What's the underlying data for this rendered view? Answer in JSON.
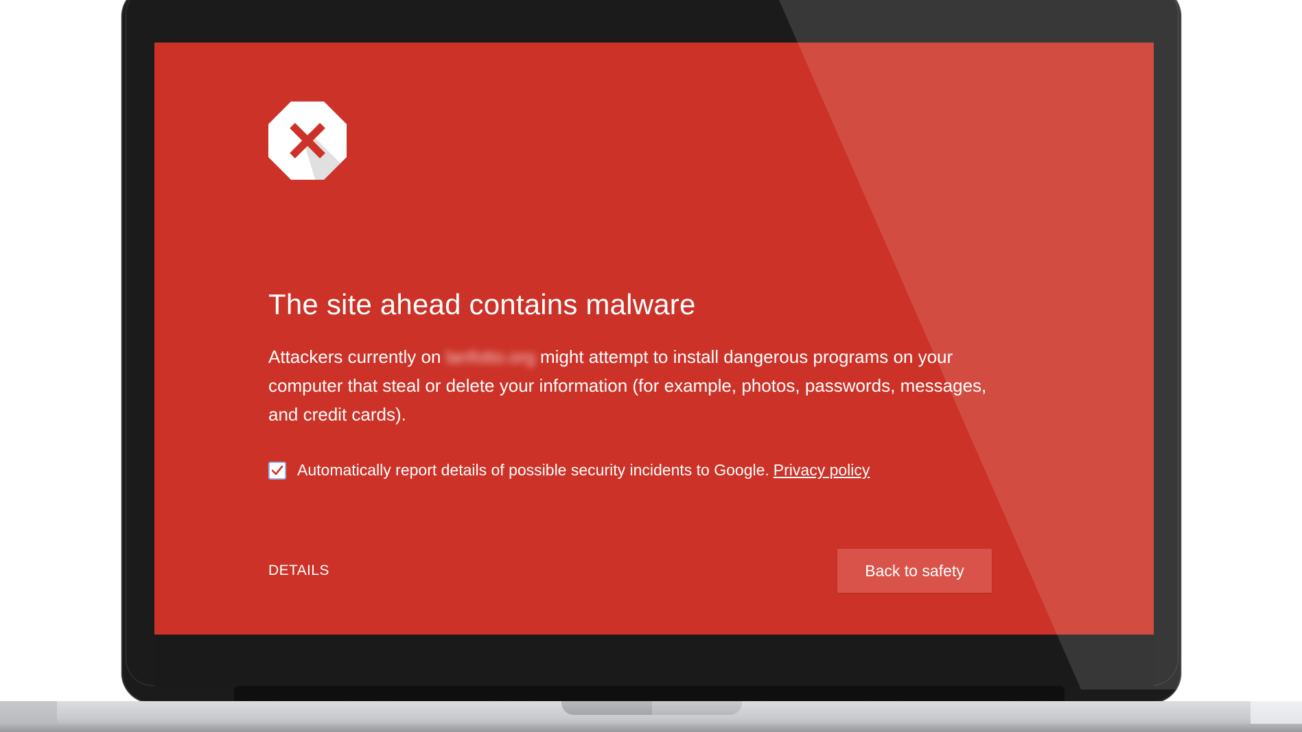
{
  "interstitial": {
    "title": "The site ahead contains malware",
    "body_prefix": "Attackers currently on ",
    "blurred_site": "lanfotto.org",
    "body_suffix": " might attempt to install dangerous programs on your computer that steal or delete your information (for example, photos, passwords, messages, and credit cards).",
    "report_checkbox_checked": true,
    "report_label": "Automatically report details of possible security incidents to Google.",
    "privacy_link": "Privacy policy",
    "details_label": "DETAILS",
    "back_button_label": "Back to safety",
    "icon": "stop-error-icon"
  },
  "colors": {
    "screen_background": "#cc3227",
    "button_background": "#d9534a",
    "icon_mark": "#cc3227",
    "checkbox_border": "#9bb4e6"
  }
}
